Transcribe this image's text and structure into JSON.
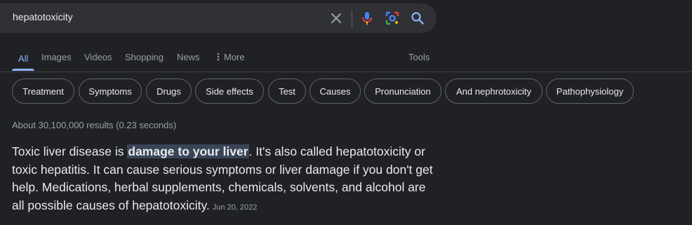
{
  "search": {
    "query": "hepatotoxicity"
  },
  "icons": {
    "clear": "close-icon",
    "voice": "microphone-icon",
    "lens": "lens-icon",
    "search": "search-icon"
  },
  "colors": {
    "background": "#202124",
    "searchbox": "#303134",
    "accent": "#8ab4f8",
    "highlight": "#394457"
  },
  "tabs": {
    "all": "All",
    "images": "Images",
    "videos": "Videos",
    "shopping": "Shopping",
    "news": "News",
    "more": "More",
    "tools": "Tools"
  },
  "chips": [
    "Treatment",
    "Symptoms",
    "Drugs",
    "Side effects",
    "Test",
    "Causes",
    "Pronunciation",
    "And nephrotoxicity",
    "Pathophysiology"
  ],
  "result_stats": "About 30,100,000 results (0.23 seconds)",
  "snippet": {
    "before": "Toxic liver disease is ",
    "highlight": "damage to your liver",
    "after": ". It's also called hepatotoxicity or toxic hepatitis. It can cause serious symptoms or liver damage if you don't get help. Medications, herbal supplements, chemicals, solvents, and alcohol are all possible causes of hepatotoxicity.",
    "date": "Jun 20, 2022"
  }
}
